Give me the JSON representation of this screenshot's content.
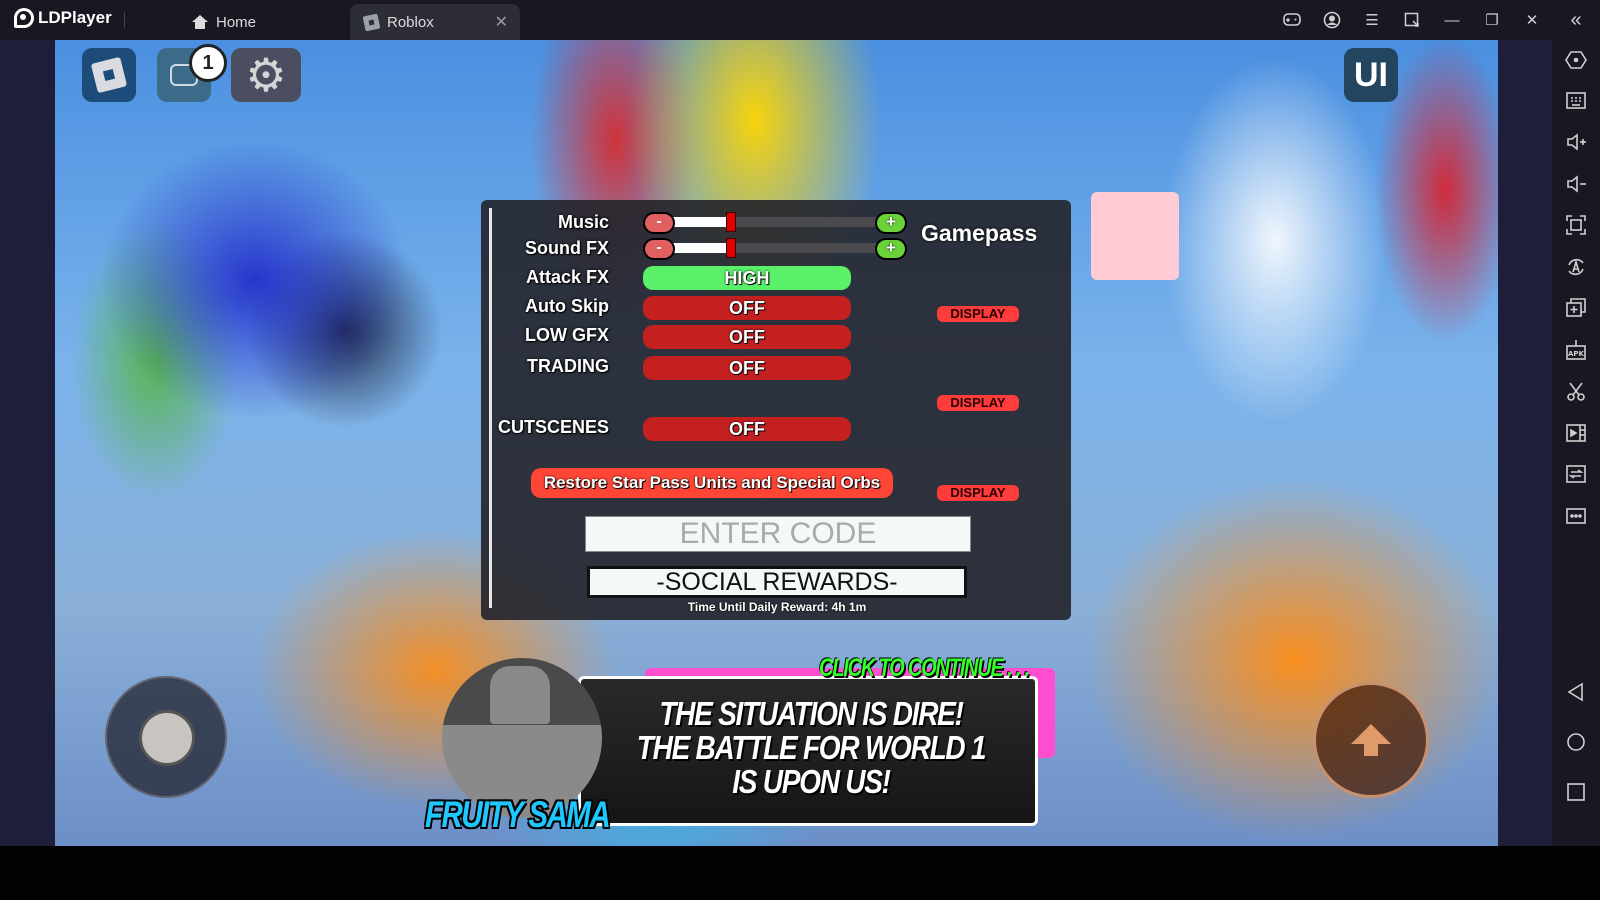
{
  "window": {
    "app_name": "LDPlayer",
    "tabs": [
      {
        "label": "Home",
        "icon": "home-icon",
        "active": false
      },
      {
        "label": "Roblox",
        "icon": "roblox-icon",
        "active": true,
        "close_symbol": "✕"
      }
    ],
    "controls": [
      {
        "name": "gamepad-icon"
      },
      {
        "name": "account-icon"
      },
      {
        "name": "menu-icon",
        "symbol": "☰"
      },
      {
        "name": "screen-rotate-icon"
      },
      {
        "name": "minimize-icon",
        "symbol": "—"
      },
      {
        "name": "restore-icon",
        "symbol": "❐"
      },
      {
        "name": "close-icon",
        "symbol": "✕"
      },
      {
        "name": "collapse-sidebar-icon",
        "symbol": "«"
      }
    ]
  },
  "sidebar": {
    "items": [
      {
        "name": "settings-hex-icon"
      },
      {
        "name": "keyboard-icon"
      },
      {
        "name": "volume-up-icon"
      },
      {
        "name": "volume-down-icon"
      },
      {
        "name": "fullscreen-icon"
      },
      {
        "name": "auto-rotate-icon"
      },
      {
        "name": "multi-instance-icon"
      },
      {
        "name": "apk-install-icon"
      },
      {
        "name": "screenshot-scissors-icon"
      },
      {
        "name": "record-video-icon"
      },
      {
        "name": "sync-icon"
      },
      {
        "name": "more-icon"
      },
      {
        "name": "back-icon"
      },
      {
        "name": "home-circle-icon"
      },
      {
        "name": "recent-apps-icon"
      }
    ]
  },
  "hud": {
    "chat_badge_count": "1",
    "ui_button_label": "UI",
    "gear_symbol": "⚙"
  },
  "settings": {
    "sliders": [
      {
        "label": "Music",
        "minus": "-",
        "plus": "+",
        "level_percent": 32
      },
      {
        "label": "Sound FX",
        "minus": "-",
        "plus": "+",
        "level_percent": 32
      }
    ],
    "toggles": [
      {
        "label": "Attack FX",
        "value": "HIGH",
        "state": "on"
      },
      {
        "label": "Auto Skip",
        "value": "OFF",
        "state": "off"
      },
      {
        "label": "LOW GFX",
        "value": "OFF",
        "state": "off"
      },
      {
        "label": "TRADING",
        "value": "OFF",
        "state": "off"
      },
      {
        "label": "CUTSCENES",
        "value": "OFF",
        "state": "off"
      }
    ],
    "gamepass_title": "Gamepass",
    "display_buttons": [
      "DISPLAY",
      "DISPLAY",
      "DISPLAY"
    ],
    "restore_button": "Restore Star Pass Units and Special Orbs",
    "code_input": {
      "placeholder": "ENTER CODE",
      "value": ""
    },
    "social_rewards_button": "-SOCIAL REWARDS-",
    "daily_reward_text": "Time Until Daily Reward: 4h 1m"
  },
  "dialog": {
    "speaker": "FRUITY SAMA",
    "continue_prompt": "CLICK TO CONTINUE . . .",
    "message": "THE SITUATION IS DIRE! THE BATTLE FOR WORLD 1 IS UPON US!"
  },
  "colors": {
    "toggle_on": "#5af06a",
    "toggle_off": "#c42020",
    "display_button": "#ff3c3c",
    "restore_button": "#ff4636",
    "continue_prompt": "#35ff2a",
    "speaker_name": "#1ec8ff",
    "gamepass_swatch": "#ffccd6"
  }
}
